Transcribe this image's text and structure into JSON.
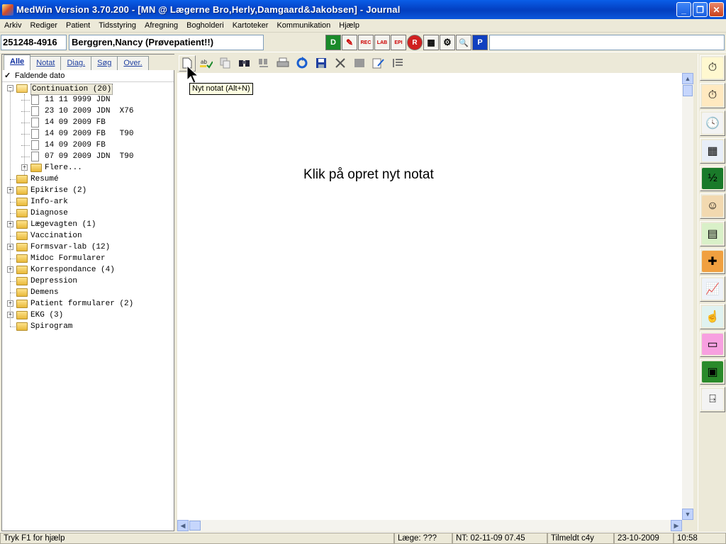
{
  "window": {
    "title": "MedWin Version 3.70.200 - [MN @ Lægerne Bro,Herly,Damgaard&Jakobsen] - Journal"
  },
  "menu": [
    "Arkiv",
    "Rediger",
    "Patient",
    "Tidsstyring",
    "Afregning",
    "Bogholderi",
    "Kartoteker",
    "Kommunikation",
    "Hjælp"
  ],
  "patient": {
    "cpr": "251248-4916",
    "name": "Berggren,Nancy (Prøvepatient!!)"
  },
  "patient_tools": [
    "D",
    "✎",
    "REC",
    "LAB",
    "EPI",
    "R",
    "▦",
    "⚙",
    "🔍",
    "P"
  ],
  "tabs": [
    "Alle",
    "Notat",
    "Diag.",
    "Søg",
    "Over."
  ],
  "sort_checkbox": {
    "label": "Faldende dato",
    "checked": true
  },
  "tree": {
    "continuation": {
      "label": "Continuation (20)",
      "items": [
        "11 11 9999 JDN",
        "23 10 2009 JDN  X76",
        "14 09 2009 FB",
        "14 09 2009 FB   T90",
        "14 09 2009 FB",
        "07 09 2009 JDN  T90"
      ],
      "more": "Flere..."
    },
    "folders": [
      {
        "label": "Resumé",
        "expandable": false
      },
      {
        "label": "Epikrise (2)",
        "expandable": true
      },
      {
        "label": "Info-ark",
        "expandable": false
      },
      {
        "label": "Diagnose",
        "expandable": false
      },
      {
        "label": "Lægevagten (1)",
        "expandable": true
      },
      {
        "label": "Vaccination",
        "expandable": false
      },
      {
        "label": "Formsvar-lab (12)",
        "expandable": true
      },
      {
        "label": "Midoc Formularer",
        "expandable": false
      },
      {
        "label": "Korrespondance (4)",
        "expandable": true
      },
      {
        "label": "Depression",
        "expandable": false
      },
      {
        "label": "Demens",
        "expandable": false
      },
      {
        "label": "Patient formularer (2)",
        "expandable": true
      },
      {
        "label": "EKG (3)",
        "expandable": true
      },
      {
        "label": "Spirogram",
        "expandable": false
      }
    ]
  },
  "toolbar_icons": [
    "new-note-icon",
    "spellcheck-icon",
    "copy-icon",
    "find-icon",
    "find-next-icon",
    "print-icon",
    "refresh-icon",
    "save-icon",
    "tools-icon",
    "blank-icon",
    "edit-icon",
    "list-icon"
  ],
  "tooltip": "Nyt notat (Alt+N)",
  "document": {
    "empty_message": "Klik på opret nyt notat"
  },
  "right_buttons": [
    "stopwatch-icon",
    "stopwatch-orange-icon",
    "clock-calendar-icon",
    "calendar-icon",
    "half-calendar-icon",
    "doctor-icon",
    "folder-form-icon",
    "injection-icon",
    "chart-icon",
    "hand-icon",
    "pink-form-icon",
    "green-chart-icon",
    "exit-door-icon"
  ],
  "status": {
    "help": "Tryk F1 for hjælp",
    "doctor": "Læge: ???",
    "nt": "NT: 02-11-09 07.45",
    "registered": "Tilmeldt c4y",
    "date": "23-10-2009",
    "time": "10:58"
  }
}
